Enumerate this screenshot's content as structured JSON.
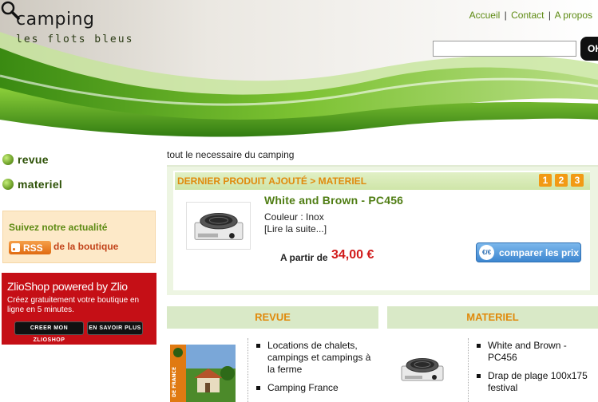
{
  "site": {
    "title": "camping",
    "tagline": "les flots bleus"
  },
  "topnav": {
    "home": "Accueil",
    "contact": "Contact",
    "about": "A propos",
    "separator": "|"
  },
  "search": {
    "value": "",
    "placeholder": "",
    "button": "OK"
  },
  "sidebar": {
    "categories": [
      {
        "label": "revue"
      },
      {
        "label": "materiel"
      }
    ],
    "follow": {
      "title": "Suivez notre actualité",
      "rss_label": "RSS",
      "link": "de la boutique"
    },
    "zlio": {
      "title": "ZlioShop powered by Zlio",
      "text": "Créez gratuitement votre boutique en ligne en 5 minutes.",
      "btn_create": "CREER MON ZLIOSHOP",
      "btn_more": "EN SAVOIR PLUS"
    }
  },
  "main": {
    "intro": "tout le necessaire du camping",
    "featured": {
      "breadcrumb": "DERNIER PRODUIT AJOUTÉ > MATERIEL",
      "pages": [
        "1",
        "2",
        "3"
      ],
      "name": "White and Brown - PC456",
      "attribute": "Couleur : Inox",
      "read_more": "[Lire la suite...]",
      "price_label": "A partir de",
      "price": "34,00 €",
      "compare_label": "comparer les prix",
      "compare_icon": "€/€"
    },
    "columns": [
      {
        "title": "REVUE",
        "items": [
          "Locations de chalets, campings et campings à la ferme",
          "Camping France"
        ]
      },
      {
        "title": "MATERIEL",
        "items": [
          "White and Brown - PC456",
          "Drap de plage 100x175 festival"
        ]
      }
    ],
    "revue_thumb_label": "DE FRANCE"
  },
  "colors": {
    "brand_green": "#5d8a12",
    "accent_orange": "#e08a0c",
    "price_red": "#d11a1a",
    "zlio_red": "#c50f16"
  }
}
